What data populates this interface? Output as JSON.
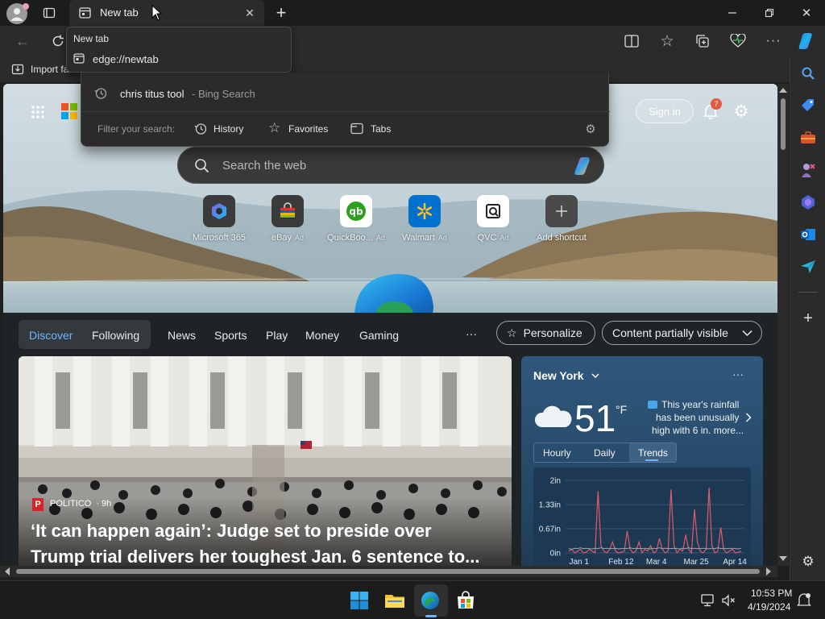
{
  "tab": {
    "title": "New tab"
  },
  "tooltip": {
    "title": "New tab",
    "url": "edge://newtab"
  },
  "dropdown": {
    "suggestion": "chris titus tool",
    "suggestion_suffix": " - Bing Search",
    "filter_label": "Filter your search:",
    "filters": [
      "History",
      "Favorites",
      "Tabs"
    ]
  },
  "favbar": {
    "import_label": "Import fa"
  },
  "header": {
    "sign_in": "Sign in",
    "notification_count": "7"
  },
  "search": {
    "placeholder": "Search the web"
  },
  "shortcuts": [
    {
      "label": "Microsoft 365",
      "ad": ""
    },
    {
      "label": "eBay",
      "ad": "Ad"
    },
    {
      "label": "QuickBoo...",
      "ad": "Ad"
    },
    {
      "label": "Walmart",
      "ad": "Ad"
    },
    {
      "label": "QVC",
      "ad": "Ad"
    },
    {
      "label": "Add shortcut",
      "ad": ""
    }
  ],
  "feed_nav": {
    "discover": "Discover",
    "following": "Following",
    "tabs": [
      "News",
      "Sports",
      "Play",
      "Money",
      "Gaming"
    ],
    "more": "···",
    "personalize": "Personalize",
    "content_visibility": "Content partially visible"
  },
  "article": {
    "source": "POLITICO",
    "age": "9h",
    "headline_line1": "‘It can happen again’: Judge set to preside over",
    "headline_line2": "Trump trial delivers her toughest Jan. 6 sentence to..."
  },
  "weather": {
    "location": "New York",
    "temperature": "51",
    "unit": "°F",
    "note_line1": "This year's rainfall",
    "note_line2": "has been unusually",
    "note_line3": "high with 6 in. more...",
    "tabs": [
      "Hourly",
      "Daily",
      "Trends"
    ],
    "active_tab": "Trends"
  },
  "chart_data": {
    "type": "line",
    "ylabel": "",
    "yticks": [
      "0in",
      "0.67in",
      "1.33in",
      "2in"
    ],
    "ylim": [
      0,
      2
    ],
    "xticks": [
      "Jan 1",
      "Feb 12",
      "Mar 4",
      "Mar 25",
      "Apr 14"
    ],
    "series": [
      {
        "values": [
          0.05,
          0.1,
          0.0,
          0.05,
          0.1,
          0.0,
          0.02,
          0.1,
          0.05,
          0.0,
          1.7,
          0.2,
          0.05,
          0.0,
          0.1,
          0.3,
          0.05,
          0.0,
          0.02,
          0.05,
          0.6,
          0.1,
          0.0,
          0.05,
          0.3,
          0.0,
          0.1,
          0.05,
          0.2,
          0.0,
          0.05,
          0.4,
          0.1,
          0.0,
          0.05,
          1.75,
          0.2,
          0.0,
          0.1,
          0.05,
          0.5,
          0.1,
          0.0,
          1.2,
          0.3,
          0.05,
          0.0,
          0.1,
          1.8,
          0.2,
          0.0,
          0.05,
          0.7,
          0.1,
          0.0,
          0.05,
          0.1,
          0.0,
          0.02,
          0.05
        ]
      },
      {
        "values": [
          0.12,
          0.1,
          0.13,
          0.12,
          0.14,
          0.12,
          0.13,
          0.12,
          0.11,
          0.13,
          0.12,
          0.14,
          0.12,
          0.13,
          0.12,
          0.12,
          0.13,
          0.11,
          0.12,
          0.13,
          0.12,
          0.14,
          0.12,
          0.13,
          0.12,
          0.12,
          0.13,
          0.12,
          0.11,
          0.13,
          0.12,
          0.14,
          0.12,
          0.13,
          0.12,
          0.12,
          0.13,
          0.12,
          0.11,
          0.13,
          0.12,
          0.14,
          0.12,
          0.13,
          0.12,
          0.12,
          0.13,
          0.12,
          0.11,
          0.13,
          0.12,
          0.14,
          0.12,
          0.13,
          0.12,
          0.12,
          0.13,
          0.12,
          0.11,
          0.13
        ]
      }
    ],
    "colors": [
      "#e05a6a",
      "#9aa6b2"
    ]
  },
  "taskbar": {
    "time": "10:53 PM",
    "date": "4/19/2024"
  },
  "colors": {
    "accent": "#1f6fd1",
    "bg": "#1f1f1f"
  }
}
